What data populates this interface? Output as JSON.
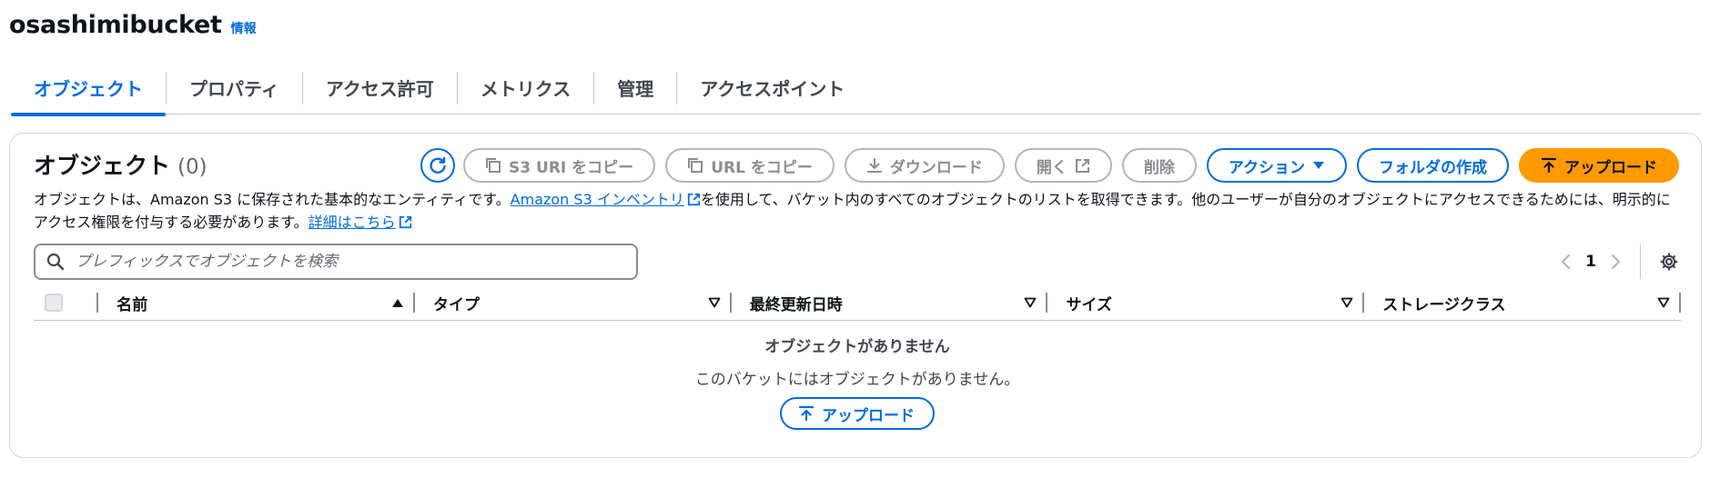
{
  "header": {
    "bucket_name": "osashimibucket",
    "info_label": "情報"
  },
  "tabs": [
    {
      "label": "オブジェクト",
      "active": true
    },
    {
      "label": "プロパティ",
      "active": false
    },
    {
      "label": "アクセス許可",
      "active": false
    },
    {
      "label": "メトリクス",
      "active": false
    },
    {
      "label": "管理",
      "active": false
    },
    {
      "label": "アクセスポイント",
      "active": false
    }
  ],
  "objects": {
    "title": "オブジェクト",
    "count": "(0)",
    "toolbar": {
      "copy_s3_uri": "S3 URI をコピー",
      "copy_url": "URL をコピー",
      "download": "ダウンロード",
      "open": "開く",
      "delete": "削除",
      "actions": "アクション",
      "create_folder": "フォルダの作成",
      "upload": "アップロード"
    },
    "description": {
      "part1": "オブジェクトは、Amazon S3 に保存された基本的なエンティティです。",
      "link1": "Amazon S3 インベントリ",
      "part2": "を使用して、バケット内のすべてのオブジェクトのリストを取得できます。他のユーザーが自分のオブジェクトにアクセスできるためには、明示的にアクセス権限を付与する必要があります。",
      "link2": "詳細はこちら"
    },
    "search": {
      "placeholder": "プレフィックスでオブジェクトを検索",
      "value": ""
    },
    "pagination": {
      "current_page": "1"
    },
    "columns": [
      "名前",
      "タイプ",
      "最終更新日時",
      "サイズ",
      "ストレージクラス"
    ],
    "sort": {
      "column": "名前",
      "direction": "ascending"
    },
    "empty": {
      "title": "オブジェクトがありません",
      "description": "このバケットにはオブジェクトがありません。",
      "upload_label": "アップロード"
    }
  },
  "colors": {
    "accent": "#006ce0",
    "primary_button": "#ff9900",
    "disabled": "#8c8c94"
  }
}
